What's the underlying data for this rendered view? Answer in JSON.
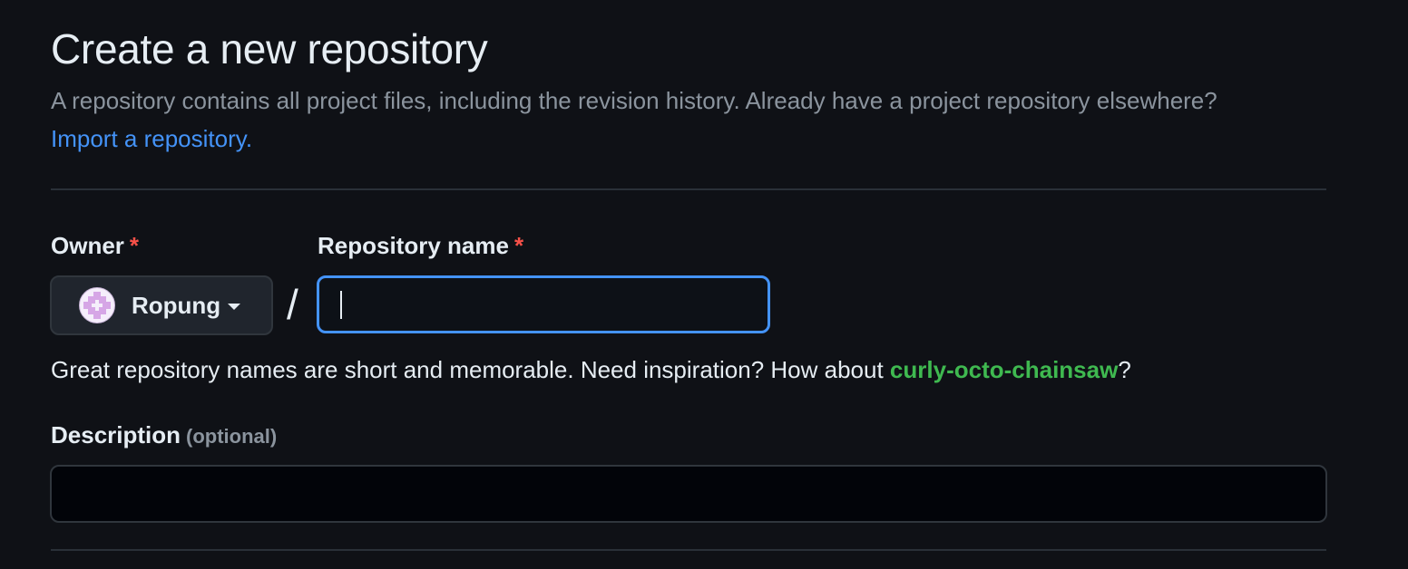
{
  "header": {
    "title": "Create a new repository",
    "subtitle": "A repository contains all project files, including the revision history. Already have a project repository elsewhere?",
    "import_link": "Import a repository."
  },
  "owner": {
    "label": "Owner",
    "required_mark": "*",
    "selected": "Ropung",
    "avatar_icon": "identicon-avatar",
    "avatar_color": "#d6a6e6"
  },
  "separator": "/",
  "repo_name": {
    "label": "Repository name",
    "required_mark": "*",
    "value": "",
    "focused": true
  },
  "hint": {
    "prefix": "Great repository names are short and memorable. Need inspiration? How about ",
    "suggestion": "curly-octo-chainsaw",
    "suffix": "?"
  },
  "description": {
    "label": "Description",
    "optional_note": "(optional)",
    "value": ""
  },
  "colors": {
    "background": "#0f1116",
    "link": "#4493f8",
    "required": "#f85149",
    "suggestion": "#3fb950",
    "focus_border": "#4493f8"
  }
}
